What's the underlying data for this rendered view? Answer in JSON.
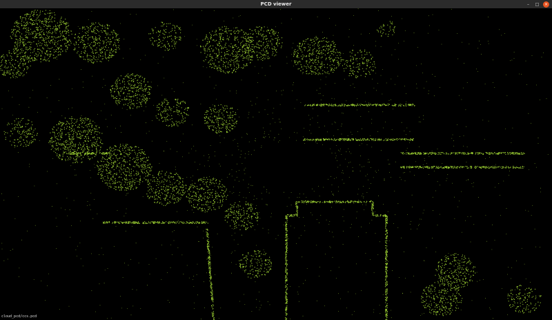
{
  "window": {
    "title": "PCD viewer",
    "controls": {
      "minimize": "–",
      "maximize": "□",
      "close": "×"
    }
  },
  "viewport": {
    "point_color": "#9acd32",
    "background": "#000000",
    "status_text": "cloud_pcd/ccs.pcd"
  },
  "colors": {
    "titlebar": "#2b2b2b",
    "close_button": "#e95420"
  }
}
